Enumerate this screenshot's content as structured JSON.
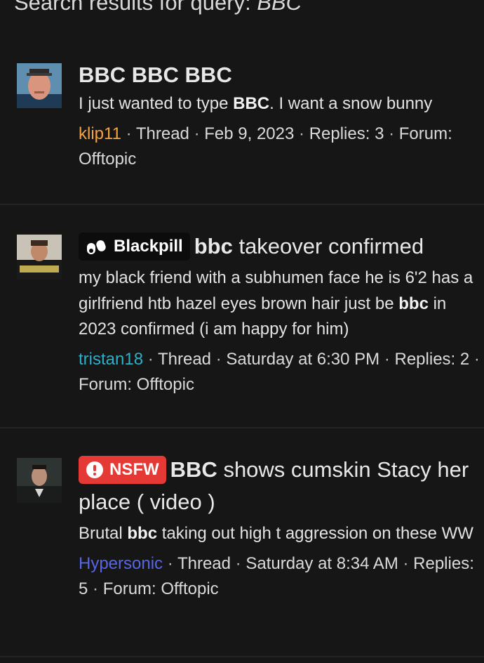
{
  "header": {
    "prefix": "Search results for query: ",
    "query": "BBC"
  },
  "colors": {
    "background": "#161616",
    "user_klip11": "#f4a340",
    "user_tristan18": "#2ab0c8",
    "user_hypersonic": "#5765e6",
    "badge_blackpill_bg": "#0c0c0c",
    "badge_nsfw_bg": "#e53935"
  },
  "results": [
    {
      "title_parts": [
        "BBC BBC BBC"
      ],
      "snippet": {
        "before": "I just wanted to type ",
        "bold": "BBC",
        "after": ". I want a snow bunny"
      },
      "author": "klip11",
      "type": "Thread",
      "date": "Feb 9, 2023",
      "replies": "Replies: 3",
      "forum": "Forum: Offtopic",
      "avatar_icon": "avatar-man-bald-icon"
    },
    {
      "badge": {
        "label": "Blackpill",
        "icon": "pill-icon"
      },
      "title_bold": "bbc",
      "title_rest": " takeover confirmed",
      "snippet": {
        "before": "my black friend with a subhumen face he is 6'2 has a girlfriend htb hazel eyes brown hair just be ",
        "bold": "bbc",
        "after": " in 2023 confirmed (i am happy for him)"
      },
      "author": "tristan18",
      "type": "Thread",
      "date": "Saturday at 6:30 PM",
      "replies": "Replies: 2",
      "forum": "Forum: Offtopic",
      "avatar_icon": "avatar-man-sweater-icon"
    },
    {
      "badge": {
        "label": "NSFW",
        "icon": "alert-icon"
      },
      "title_bold": "BBC",
      "title_rest": " shows cumskin Stacy her place ( video )",
      "snippet": {
        "before": "Brutal ",
        "bold": "bbc",
        "after": " taking out high t aggression on these WW"
      },
      "author": "Hypersonic",
      "type": "Thread",
      "date": "Saturday at 8:34 AM",
      "replies": "Replies: 5",
      "forum": "Forum: Offtopic",
      "avatar_icon": "avatar-man-suit-icon"
    }
  ],
  "separator": "·"
}
